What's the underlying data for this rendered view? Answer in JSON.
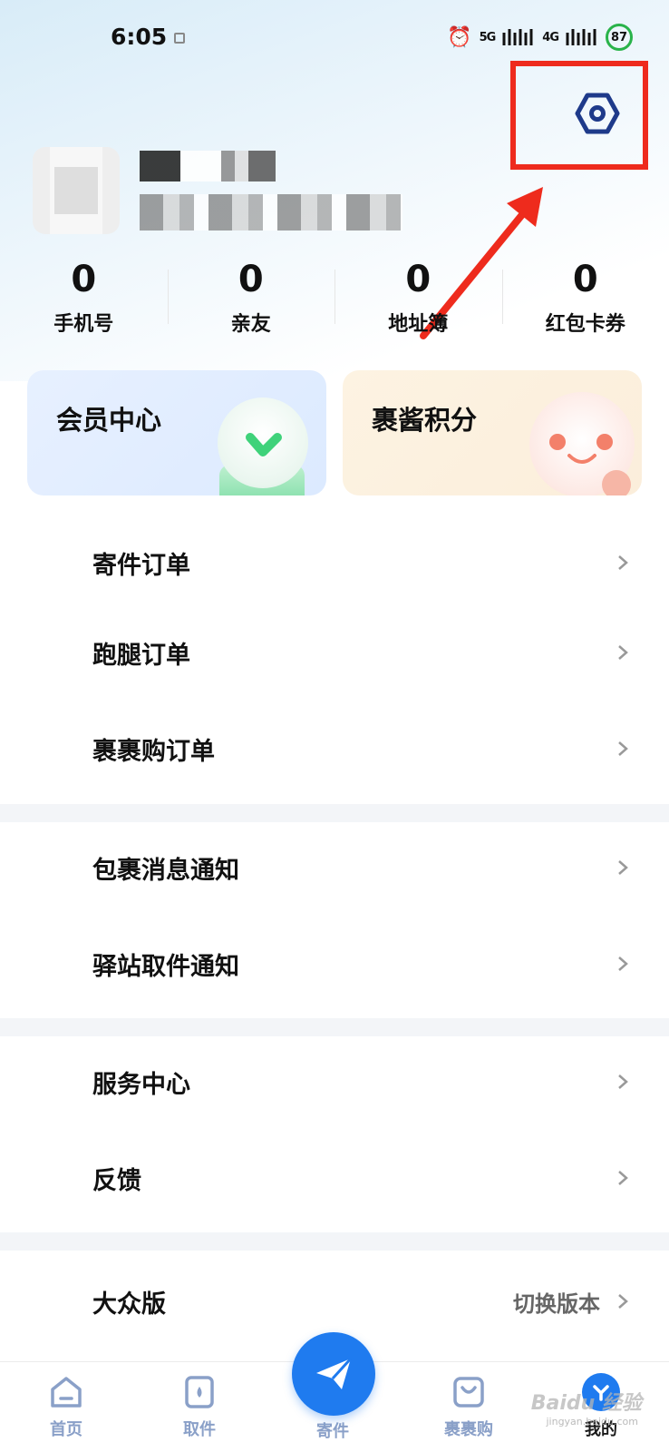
{
  "status_bar": {
    "time": "6:05",
    "network_left": "5G",
    "network_right": "4G",
    "battery": "87",
    "icons": [
      "alarm-icon",
      "signal-icon",
      "battery-icon"
    ]
  },
  "stats": [
    {
      "value": "0",
      "label": "手机号"
    },
    {
      "value": "0",
      "label": "亲友"
    },
    {
      "value": "0",
      "label": "地址簿"
    },
    {
      "value": "0",
      "label": "红包卡券"
    }
  ],
  "cards": {
    "member": "会员中心",
    "points": "裹酱积分"
  },
  "menu": {
    "orders": [
      "寄件订单",
      "跑腿订单",
      "裹裹购订单"
    ],
    "notifications": [
      "包裹消息通知",
      "驿站取件通知"
    ],
    "support": [
      "服务中心",
      "反馈"
    ],
    "version": {
      "label": "大众版",
      "action": "切换版本"
    }
  },
  "tabbar": [
    {
      "label": "首页",
      "icon": "home-icon"
    },
    {
      "label": "取件",
      "icon": "pickup-icon"
    },
    {
      "label": "寄件",
      "icon": "send-icon"
    },
    {
      "label": "裹裹购",
      "icon": "shop-bag-icon"
    },
    {
      "label": "我的",
      "icon": "profile-icon"
    }
  ],
  "watermark": {
    "text": "Baidu 经验",
    "sub": "jingyan.baidu.com"
  },
  "colors": {
    "accent": "#1f7bef",
    "highlight": "#ee2b1d",
    "tab_inactive": "#8aa0c8",
    "battery": "#29b34a"
  }
}
